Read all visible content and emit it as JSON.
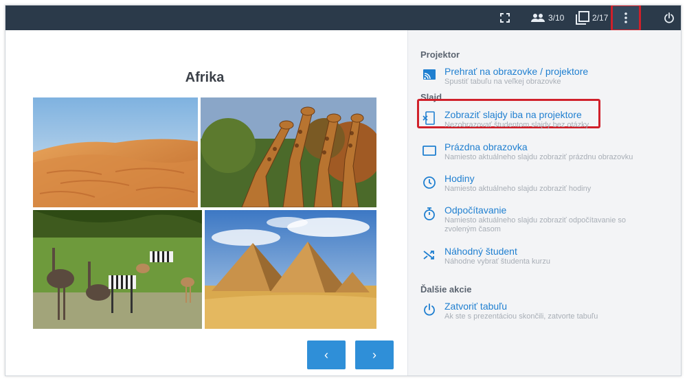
{
  "topbar": {
    "users_count": "3/10",
    "slides_count": "2/17"
  },
  "slide": {
    "title": "Afrika"
  },
  "nav": {
    "prev_label": "‹",
    "next_label": "›"
  },
  "panel": {
    "sections": {
      "projector": "Projektor",
      "slide": "Slajd",
      "more": "Ďalšie akcie"
    },
    "items": [
      {
        "title": "Prehrať na obrazovke / projektore",
        "desc": "Spustiť tabuľu na veľkej obrazovke",
        "icon": "cast-icon"
      },
      {
        "title": "Zobraziť slajdy iba na projektore",
        "desc": "Nezobrazovať študentom slajdy bez otázky",
        "icon": "slide-projector-icon"
      },
      {
        "title": "Prázdna obrazovka",
        "desc": "Namiesto aktuálneho slajdu zobraziť prázdnu obrazovku",
        "icon": "blank-screen-icon"
      },
      {
        "title": "Hodiny",
        "desc": "Namiesto aktuálneho slajdu zobraziť hodiny",
        "icon": "clock-icon"
      },
      {
        "title": "Odpočítavanie",
        "desc": "Namiesto aktuálneho slajdu zobraziť odpočítavanie so zvoleným časom",
        "icon": "timer-icon"
      },
      {
        "title": "Náhodný študent",
        "desc": "Náhodne vybrať študenta kurzu",
        "icon": "shuffle-icon"
      },
      {
        "title": "Zatvoriť tabuľu",
        "desc": "Ak ste s prezentáciou skončili, zatvorte tabuľu",
        "icon": "power-icon"
      }
    ]
  },
  "colors": {
    "topbar": "#2b3a4a",
    "accent": "#1f7fd0",
    "button": "#2f8fd8",
    "highlight": "#d0202a"
  }
}
